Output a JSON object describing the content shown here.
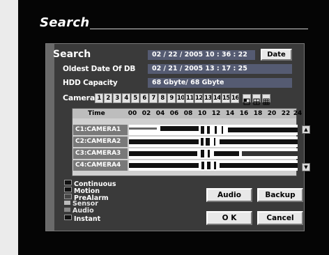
{
  "screen": {
    "title": "Search"
  },
  "panel": {
    "heading": "Search",
    "current_datetime": "02 / 22 / 2005  10 : 36 : 22",
    "date_button": "Date",
    "oldest_date_label": "Oldest Date Of DB",
    "oldest_date_value": "02 / 21 / 2005  13 : 17 : 25",
    "hdd_label": "HDD Capacity",
    "hdd_value": "68 Gbyte/ 68 Gbyte",
    "camera_label": "Camera",
    "cameras": [
      "1",
      "2",
      "3",
      "4",
      "5",
      "6",
      "7",
      "8",
      "9",
      "10",
      "11",
      "12",
      "13",
      "14",
      "15",
      "16"
    ],
    "view_icons": [
      "single-view-icon",
      "quad-view-icon",
      "multi-view-icon"
    ]
  },
  "timeline": {
    "time_label": "Time",
    "hours": [
      "00",
      "02",
      "04",
      "06",
      "08",
      "10",
      "12",
      "14",
      "16",
      "18",
      "20",
      "22",
      "24"
    ],
    "rows": [
      {
        "label": "C1:CAMERA1"
      },
      {
        "label": "C2:CAMERA2"
      },
      {
        "label": "C3:CAMERA3"
      },
      {
        "label": "C4:CAMERA4"
      }
    ],
    "scroll_up": "▲",
    "scroll_down": "▼"
  },
  "legend": [
    {
      "label": "Continuous",
      "color": "#111111"
    },
    {
      "label": "Motion",
      "color": "#111111"
    },
    {
      "label": "PreAlarm",
      "color": "#444444"
    },
    {
      "label": "Sensor",
      "color": "#bbbbbb"
    },
    {
      "label": "Audio",
      "color": "#888888"
    },
    {
      "label": "Instant",
      "color": "#111111"
    }
  ],
  "buttons": {
    "audio": "Audio",
    "backup": "Backup",
    "ok": "O K",
    "cancel": "Cancel"
  }
}
